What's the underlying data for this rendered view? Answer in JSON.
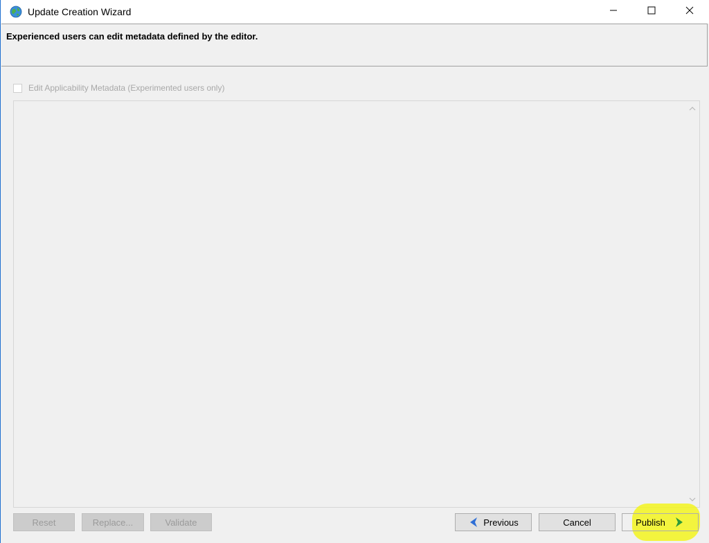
{
  "window": {
    "title": "Update Creation Wizard",
    "app_icon": "globe-icon",
    "controls": {
      "minimize_icon": "minimize-icon",
      "maximize_icon": "maximize-icon",
      "close_icon": "close-icon"
    }
  },
  "header": {
    "description": "Experienced users can edit metadata defined by the editor."
  },
  "options": {
    "edit_metadata_label": "Edit Applicability Metadata (Experimented users only)",
    "edit_metadata_checked": false,
    "edit_metadata_enabled": false
  },
  "editor_panel": {
    "scroll_up_icon": "chevron-up-icon",
    "scroll_down_icon": "chevron-down-icon"
  },
  "buttons": {
    "reset_label": "Reset",
    "replace_label": "Replace...",
    "validate_label": "Validate",
    "previous_label": "Previous",
    "cancel_label": "Cancel",
    "publish_label": "Publish"
  },
  "colors": {
    "highlight": "#f3f51f",
    "nav_arrow_previous": "#2f6fd6",
    "nav_arrow_next": "#2e9a3a"
  }
}
